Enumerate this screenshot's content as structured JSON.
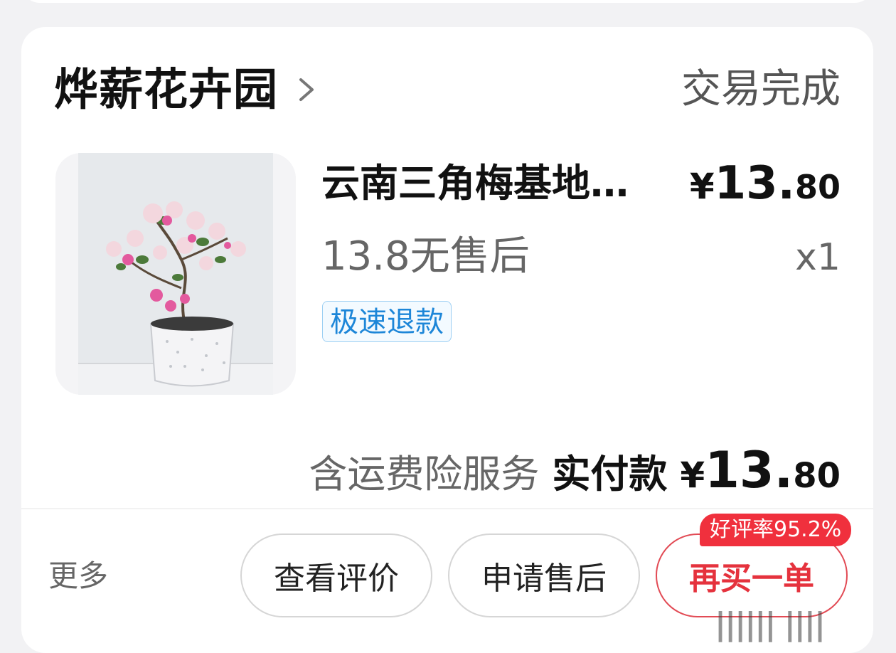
{
  "shop": {
    "name": "烨薪花卉园",
    "status": "交易完成"
  },
  "item": {
    "title": "云南三角梅基地…",
    "subtitle": "13.8无售后",
    "price_yen": "¥",
    "price_int": "13.",
    "price_dec": "80",
    "quantity": "x1",
    "tag": "极速退款",
    "image_icon": "bougainvillea-potted-plant"
  },
  "totals": {
    "insurance": "含运费险服务",
    "paid_label": "实付款",
    "yen": "¥",
    "int": "13.",
    "dec": "80"
  },
  "actions": {
    "more": "更多",
    "review": "查看评价",
    "after_sale": "申请售后",
    "rebuy": "再买一单",
    "rebuy_badge": "好评率95.2%"
  },
  "colors": {
    "accent_red": "#e5323d",
    "badge_red": "#f0303d",
    "tag_blue": "#1d86d8"
  }
}
